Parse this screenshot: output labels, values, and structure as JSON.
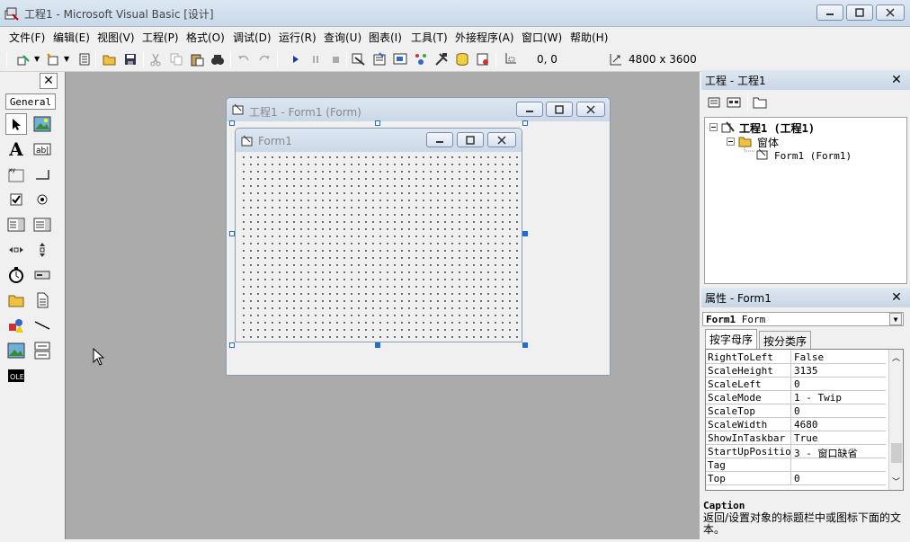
{
  "window": {
    "title": "工程1 - Microsoft Visual Basic [设计]"
  },
  "menu": [
    "文件(F)",
    "编辑(E)",
    "视图(V)",
    "工程(P)",
    "格式(O)",
    "调试(D)",
    "运行(R)",
    "查询(U)",
    "图表(I)",
    "工具(T)",
    "外接程序(A)",
    "窗口(W)",
    "帮助(H)"
  ],
  "toolbar": {
    "position": "0, 0",
    "size": "4800 x 3600"
  },
  "toolbox": {
    "tab": "General",
    "close": "✕"
  },
  "designer": {
    "outer_title": "工程1 - Form1 (Form)",
    "inner_title": "Form1"
  },
  "project": {
    "title": "工程 - 工程1",
    "close": "✕",
    "root": "工程1 (工程1)",
    "folder": "窗体",
    "item": "Form1 (Form1)"
  },
  "properties": {
    "title": "属性 - Form1",
    "close": "✕",
    "object_name": "Form1",
    "object_type": "Form",
    "tabs": [
      "按字母序",
      "按分类序"
    ],
    "rows": [
      {
        "name": "RightToLeft",
        "value": "False"
      },
      {
        "name": "ScaleHeight",
        "value": "3135"
      },
      {
        "name": "ScaleLeft",
        "value": "0"
      },
      {
        "name": "ScaleMode",
        "value": "1 - Twip"
      },
      {
        "name": "ScaleTop",
        "value": "0"
      },
      {
        "name": "ScaleWidth",
        "value": "4680"
      },
      {
        "name": "ShowInTaskbar",
        "value": "True"
      },
      {
        "name": "StartUpPosition",
        "value": "3 - 窗口缺省"
      },
      {
        "name": "Tag",
        "value": ""
      },
      {
        "name": "Top",
        "value": "0"
      }
    ],
    "desc_title": "Caption",
    "desc_text": "返回/设置对象的标题栏中或图标下面的文本。"
  }
}
